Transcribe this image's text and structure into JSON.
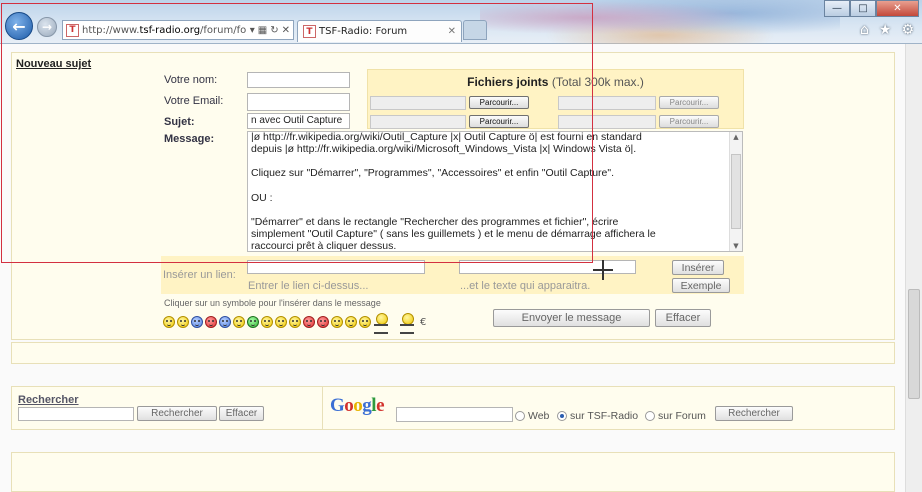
{
  "browser": {
    "url_prefix": "http://www.",
    "url_host": "tsf-radio.org",
    "url_suffix": "/forum/fo",
    "tab_title": "TSF-Radio: Forum",
    "favicon_text": "T",
    "back_icon": "back-arrow-icon",
    "forward_icon": "forward-arrow-icon"
  },
  "form": {
    "heading": "Nouveau sujet",
    "name_label": "Votre nom:",
    "email_label": "Votre Email:",
    "subject_label": "Sujet:",
    "subject_value": "n avec Outil Capture",
    "message_label": "Message:",
    "message_lines": [
      "|ø http://fr.wikipedia.org/wiki/Outil_Capture |x| Outil Capture  ö| est fourni en standard",
      "depuis |ø http://fr.wikipedia.org/wiki/Microsoft_Windows_Vista |x| Windows Vista  ö|.",
      "Cliquez sur \"Démarrer\", \"Programmes\", \"Accessoires\" et enfin \"Outil Capture\".",
      "OU :",
      "\"Démarrer\" et dans le rectangle \"Rechercher des programmes et fichier\", écrire",
      "simplement \"Outil Capture\" ( sans les guillemets ) et le menu de démarrage affichera le",
      "raccourci prêt à cliquer dessus."
    ]
  },
  "attachments": {
    "title": "Fichiers joints",
    "subtitle": "(Total 300k max.)",
    "browse_label": "Parcourir..."
  },
  "link": {
    "insert_label": "Insérer un lien:",
    "url_hint": "Entrer le lien ci-dessus...",
    "text_hint": "...et le texte qui apparaitra.",
    "insert_button": "Insérer",
    "example_button": "Exemple"
  },
  "smileys": {
    "hint": "Cliquer sur un symbole pour l'insérer dans le message",
    "euro": "€"
  },
  "actions": {
    "send": "Envoyer le message",
    "clear": "Effacer"
  },
  "search": {
    "label": "Rechercher",
    "search_button": "Rechercher",
    "clear_button": "Effacer",
    "google_search_button": "Rechercher",
    "options": [
      "Web",
      "sur TSF-Radio",
      "sur Forum"
    ],
    "selected": "sur TSF-Radio"
  },
  "colors": {
    "accent_blue": "#1d5ba8",
    "panel_yellow": "#fff3c4",
    "selection_red": "#d33040"
  }
}
